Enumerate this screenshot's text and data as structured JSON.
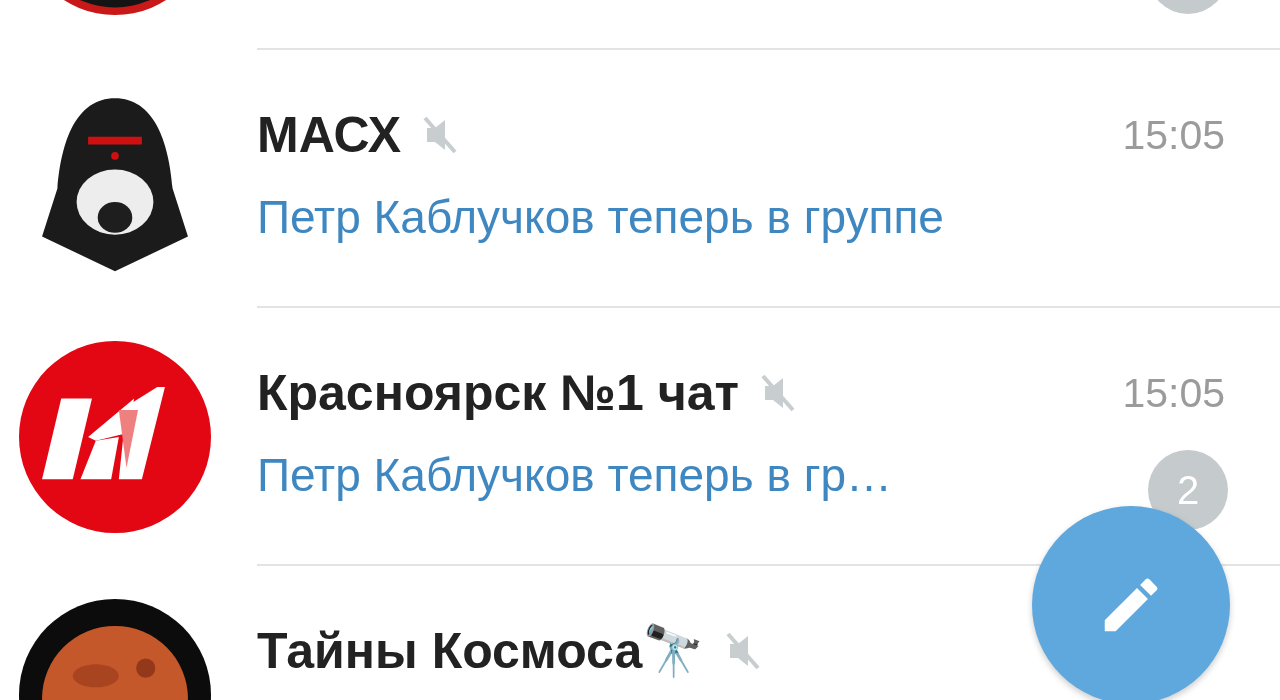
{
  "chats": [
    {
      "badge": true
    },
    {
      "name": "МАСХ",
      "muted": true,
      "time": "15:05",
      "preview": "Петр Каблучков теперь в группе"
    },
    {
      "name": "Красноярск №1 чат",
      "muted": true,
      "time": "15:05",
      "preview": "Петр Каблучков теперь в гр…",
      "badge": true,
      "unread_count": "2"
    },
    {
      "name": "Тайны Космоса🔭",
      "muted": true
    }
  ],
  "compose_button": {
    "visible": true
  }
}
